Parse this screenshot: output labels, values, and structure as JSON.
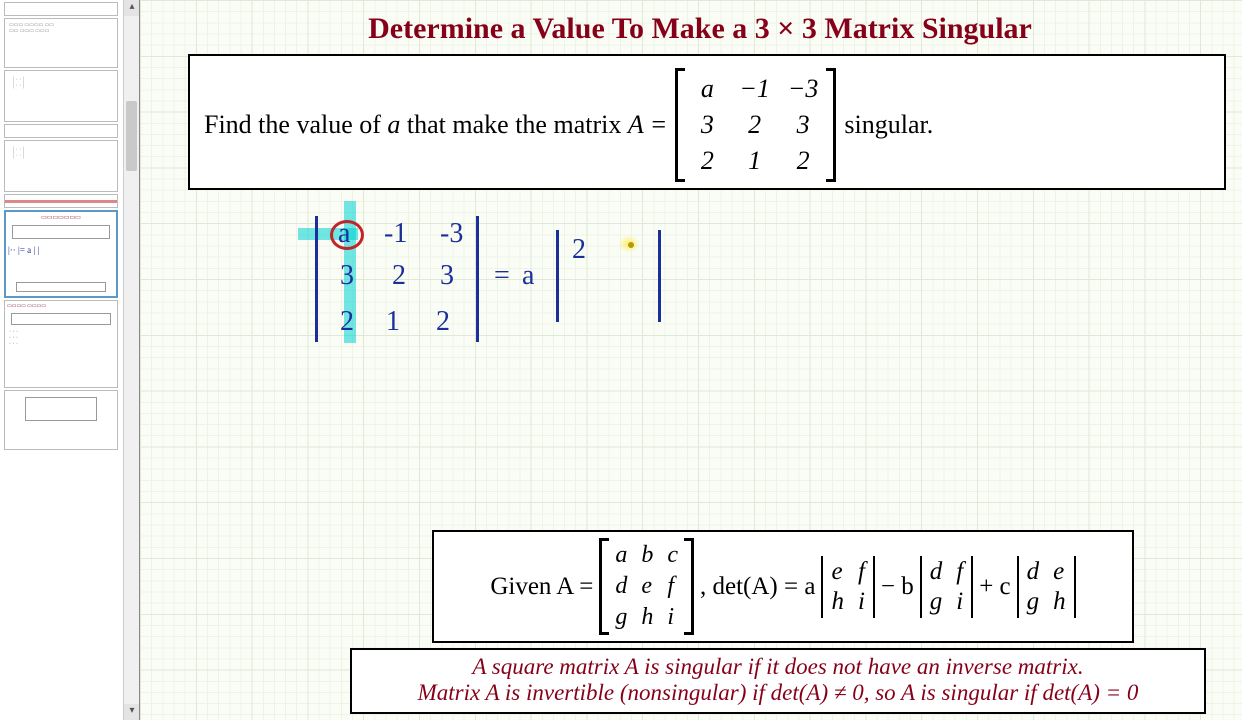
{
  "title": "Determine a Value To Make a 3 × 3 Matrix Singular",
  "problem": {
    "lead": "Find the value of ",
    "var": "a",
    "mid": " that make the matrix ",
    "mat_label": "A =",
    "tail": " singular.",
    "matrix": [
      [
        "a",
        "−1",
        "−3"
      ],
      [
        "3",
        "2",
        "3"
      ],
      [
        "2",
        "1",
        "2"
      ]
    ]
  },
  "handwriting": {
    "row1": [
      "a",
      "-1",
      "-3"
    ],
    "row2": [
      "3",
      "2",
      "3"
    ],
    "row3": [
      "2",
      "1",
      "2"
    ],
    "eq": "=",
    "coef": "a",
    "minor_val": "2"
  },
  "formula1": {
    "given": "Given A =",
    "matrix": [
      [
        "a",
        "b",
        "c"
      ],
      [
        "d",
        "e",
        "f"
      ],
      [
        "g",
        "h",
        "i"
      ]
    ],
    "det_label": ", det(A) = a",
    "m1": [
      [
        "e",
        "f"
      ],
      [
        "h",
        "i"
      ]
    ],
    "minus_b": "− b",
    "m2": [
      [
        "d",
        "f"
      ],
      [
        "g",
        "i"
      ]
    ],
    "plus_c": "+ c",
    "m3": [
      [
        "d",
        "e"
      ],
      [
        "g",
        "h"
      ]
    ]
  },
  "formula2": {
    "l1": "A square matrix A is singular if it does not have an inverse matrix.",
    "l2": "Matrix A is invertible (nonsingular) if det(A) ≠ 0, so A is singular if det(A) = 0"
  },
  "thumbs": {
    "items": [
      {
        "h": "small"
      },
      {
        "h": "t1"
      },
      {
        "h": "med"
      },
      {
        "h": "small"
      },
      {
        "h": "med"
      },
      {
        "h": "small"
      },
      {
        "h": "tall",
        "selected": true
      },
      {
        "h": "tall"
      },
      {
        "h": "tall"
      }
    ]
  }
}
